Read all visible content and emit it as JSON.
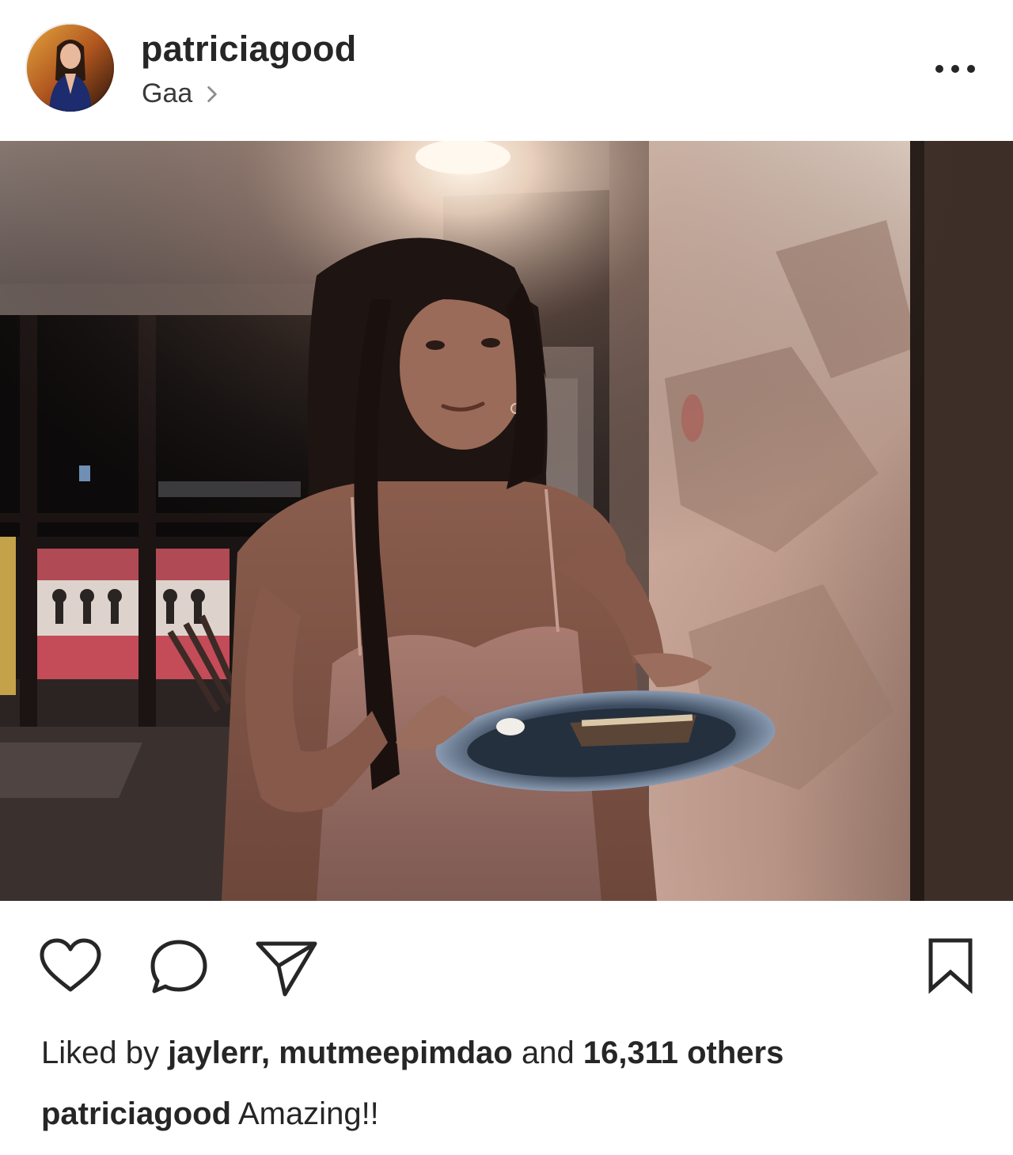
{
  "header": {
    "username": "patriciagood",
    "location": "Gaa",
    "avatar_icon": "profile-photo"
  },
  "post": {
    "image_description_icon": "photo",
    "actions": {
      "like_icon": "heart-icon",
      "comment_icon": "comment-icon",
      "share_icon": "paper-plane-icon",
      "save_icon": "bookmark-icon"
    }
  },
  "likes": {
    "prefix": "Liked by",
    "user1": "jaylerr,",
    "user2": "mutmeepimdao",
    "connector": "and",
    "others": "16,311 others"
  },
  "caption": {
    "username": "patriciagood",
    "text": "Amazing!!"
  },
  "colors": {
    "text": "#262626",
    "background": "#ffffff"
  }
}
